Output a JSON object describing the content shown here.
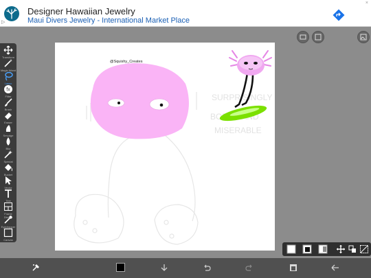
{
  "ad": {
    "title": "Designer Hawaiian Jewelry",
    "subtitle": "Maui Divers Jewelry - International Market Place",
    "close_mark": "×",
    "info_mark": "▷"
  },
  "toolbar": {
    "tools": [
      {
        "name": "transform",
        "label": "Transform",
        "icon": "move-icon"
      },
      {
        "name": "magic-wand",
        "label": "Magic Wand",
        "icon": "wand-icon"
      },
      {
        "name": "lasso",
        "label": "Lasso",
        "icon": "lasso-icon"
      },
      {
        "name": "filter",
        "label": "Filter",
        "icon": "fx-icon"
      },
      {
        "name": "brush",
        "label": "Brush",
        "icon": "brush-icon"
      },
      {
        "name": "eraser",
        "label": "Eraser",
        "icon": "eraser-icon"
      },
      {
        "name": "smudge",
        "label": "Smudge",
        "icon": "smudge-icon"
      },
      {
        "name": "blur",
        "label": "Blur",
        "icon": "drop-icon"
      },
      {
        "name": "special",
        "label": "Special",
        "icon": "sparkle-icon"
      },
      {
        "name": "bucket",
        "label": "Bucket",
        "icon": "bucket-icon"
      },
      {
        "name": "vector",
        "label": "Vector",
        "icon": "cursor-icon"
      },
      {
        "name": "text",
        "label": "Text",
        "icon": "text-icon"
      },
      {
        "name": "frame-divider",
        "label": "Frame Divider",
        "icon": "frame-icon"
      },
      {
        "name": "eyedropper",
        "label": "Eyedropper",
        "icon": "eyedropper-icon"
      },
      {
        "name": "canvas",
        "label": "Canvas",
        "icon": "canvas-icon"
      }
    ]
  },
  "artwork": {
    "signature": "@Squishy_Creates",
    "watermark_lines": [
      "SURPRISINGLY",
      "BORED AND",
      "MISERABLE"
    ]
  },
  "colors": {
    "primary_color": "#000000",
    "pink": "#fab4f6",
    "board_green": "#7be000"
  }
}
